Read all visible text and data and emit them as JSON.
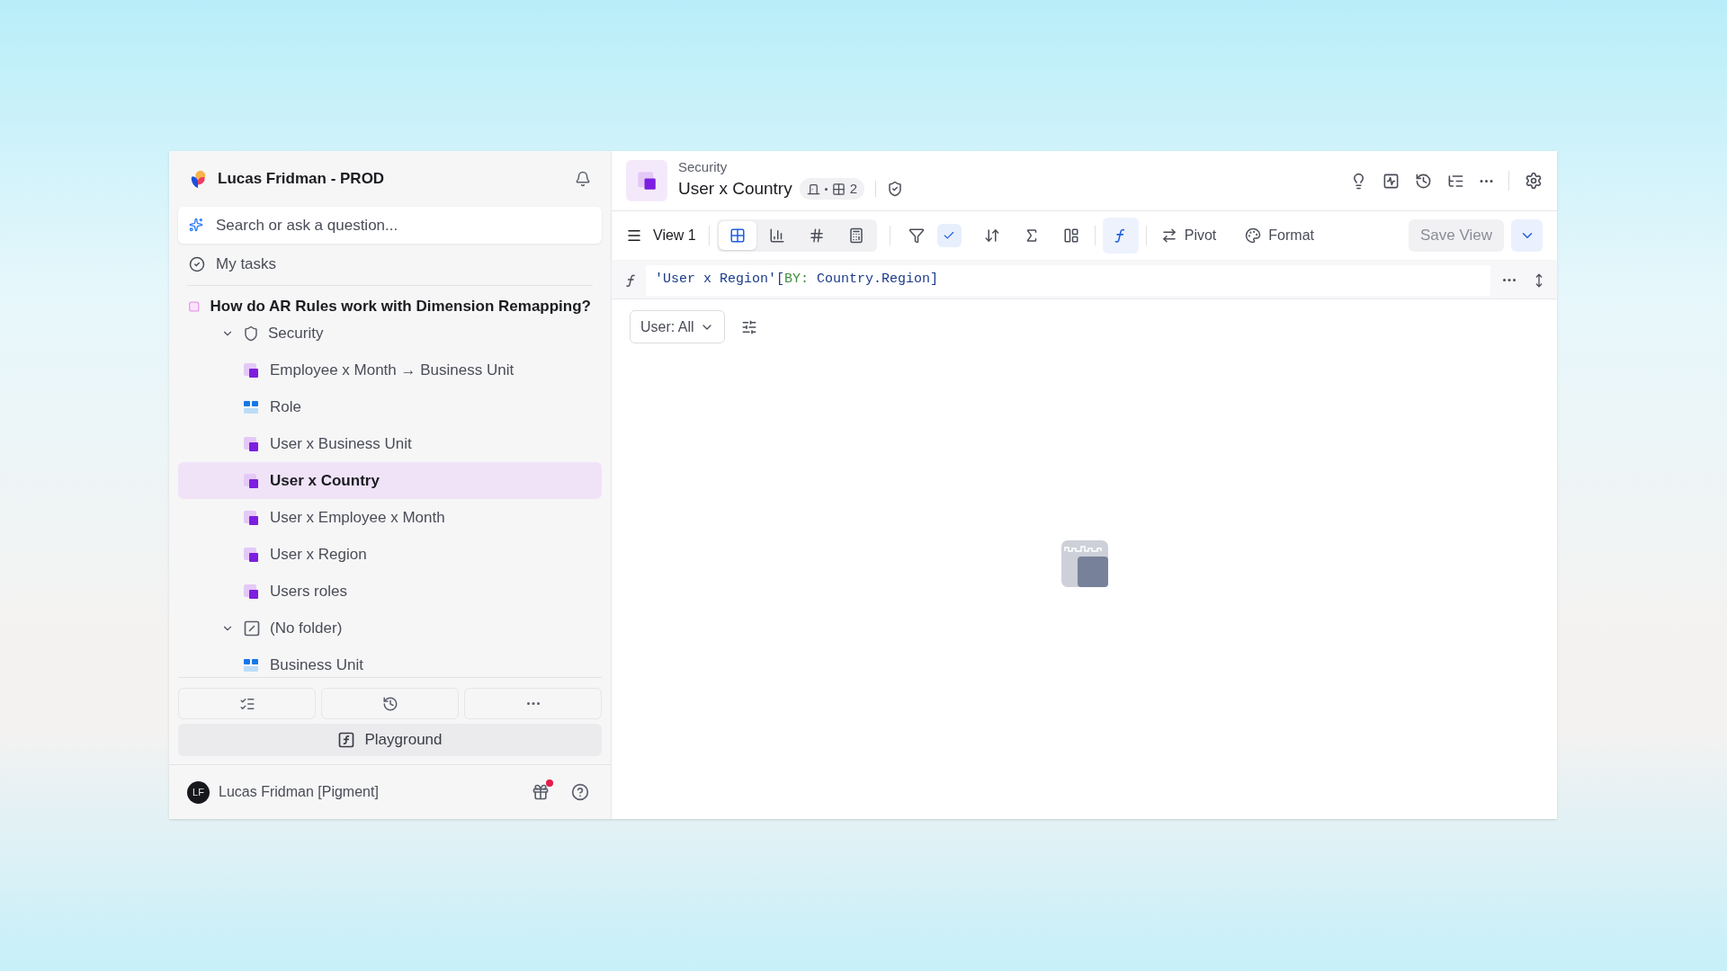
{
  "sidebar": {
    "workspace": "Lucas Fridman - PROD",
    "search": {
      "placeholder": "Search or ask a question..."
    },
    "my_tasks": "My tasks",
    "question": "How do AR Rules work with Dimension Remapping?",
    "tree": [
      {
        "label": "Security",
        "kind": "security-folder",
        "expanded": true,
        "children": [
          {
            "label": "Employee x Month → Business Unit",
            "kind": "metric",
            "selected": false
          },
          {
            "label": "Role",
            "kind": "dimension",
            "selected": false
          },
          {
            "label": "User x Business Unit",
            "kind": "metric",
            "selected": false
          },
          {
            "label": "User x Country",
            "kind": "metric",
            "selected": true
          },
          {
            "label": "User x Employee x Month",
            "kind": "metric",
            "selected": false
          },
          {
            "label": "User x Region",
            "kind": "metric",
            "selected": false
          },
          {
            "label": "Users roles",
            "kind": "metric",
            "selected": false
          }
        ]
      },
      {
        "label": "(No folder)",
        "kind": "no-folder",
        "expanded": true,
        "children": [
          {
            "label": "Business Unit",
            "kind": "dimension",
            "selected": false
          }
        ]
      }
    ],
    "playground": "Playground",
    "user": {
      "initials": "LF",
      "name": "Lucas Fridman [Pigment]",
      "gift_unread": true
    }
  },
  "header": {
    "breadcrumb": "Security",
    "title": "User x Country",
    "dimension_count": "2"
  },
  "toolbar": {
    "view": "View 1",
    "view_types": [
      {
        "kind": "grid",
        "selected": true
      },
      {
        "kind": "chart",
        "selected": false
      },
      {
        "kind": "kpi",
        "selected": false
      },
      {
        "kind": "sheet",
        "selected": false
      }
    ],
    "filter_applied": true,
    "formula_active": true,
    "pivot": "Pivot",
    "format": "Format",
    "save": {
      "label": "Save View",
      "disabled": true
    }
  },
  "formula": [
    {
      "text": "'User x Region'[",
      "kind": "name"
    },
    {
      "text": "BY:",
      "kind": "keyword"
    },
    {
      "text": " Country.Region]",
      "kind": "name"
    }
  ],
  "page_filter": "User: All"
}
